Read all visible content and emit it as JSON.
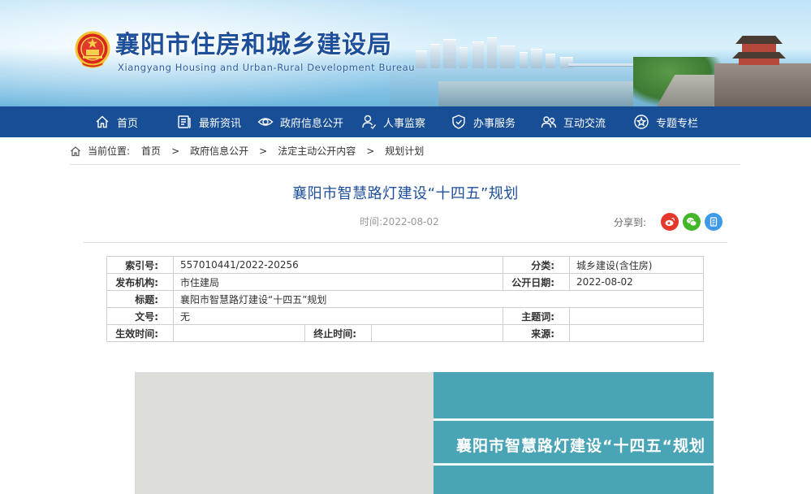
{
  "header": {
    "title": "襄阳市住房和城乡建设局",
    "subtitle": "Xiangyang Housing and Urban-Rural Development Bureau"
  },
  "nav": {
    "items": [
      {
        "label": "首页",
        "icon": "home-icon"
      },
      {
        "label": "最新资讯",
        "icon": "news-icon"
      },
      {
        "label": "政府信息公开",
        "icon": "eye-icon"
      },
      {
        "label": "人事监察",
        "icon": "person-icon"
      },
      {
        "label": "办事服务",
        "icon": "service-icon"
      },
      {
        "label": "互动交流",
        "icon": "people-icon"
      },
      {
        "label": "专题专栏",
        "icon": "star-icon"
      }
    ]
  },
  "breadcrumb": {
    "prefix": "当前位置:",
    "items": [
      "首页",
      "政府信息公开",
      "法定主动公开内容",
      "规划计划"
    ],
    "separator": ">"
  },
  "article": {
    "title": "襄阳市智慧路灯建设“十四五”规划",
    "time": "时间:2022-08-02",
    "share_label": "分享到:",
    "share_targets": [
      "weibo-icon",
      "wechat-icon",
      "copy-icon"
    ]
  },
  "info": {
    "index_no_label": "索引号:",
    "index_no": "557010441/2022-20256",
    "category_label": "分类:",
    "category": "城乡建设(含住房)",
    "publisher_label": "发布机构:",
    "publisher": "市住建局",
    "pub_date_label": "公开日期:",
    "pub_date": "2022-08-02",
    "title_label": "标题:",
    "title": "襄阳市智慧路灯建设“十四五”规划",
    "doc_no_label": "文号:",
    "doc_no": "无",
    "subject_label": "主题词:",
    "subject": "",
    "effective_label": "生效时间:",
    "effective": "",
    "expire_label": "终止时间:",
    "expire": "",
    "source_label": "来源:",
    "source": ""
  },
  "cover": {
    "title": "襄阳市智慧路灯建设“十四五“规划"
  },
  "colors": {
    "brand_blue": "#174e96",
    "title_blue": "#1d4f9a",
    "cover_teal": "#49a4b6"
  }
}
